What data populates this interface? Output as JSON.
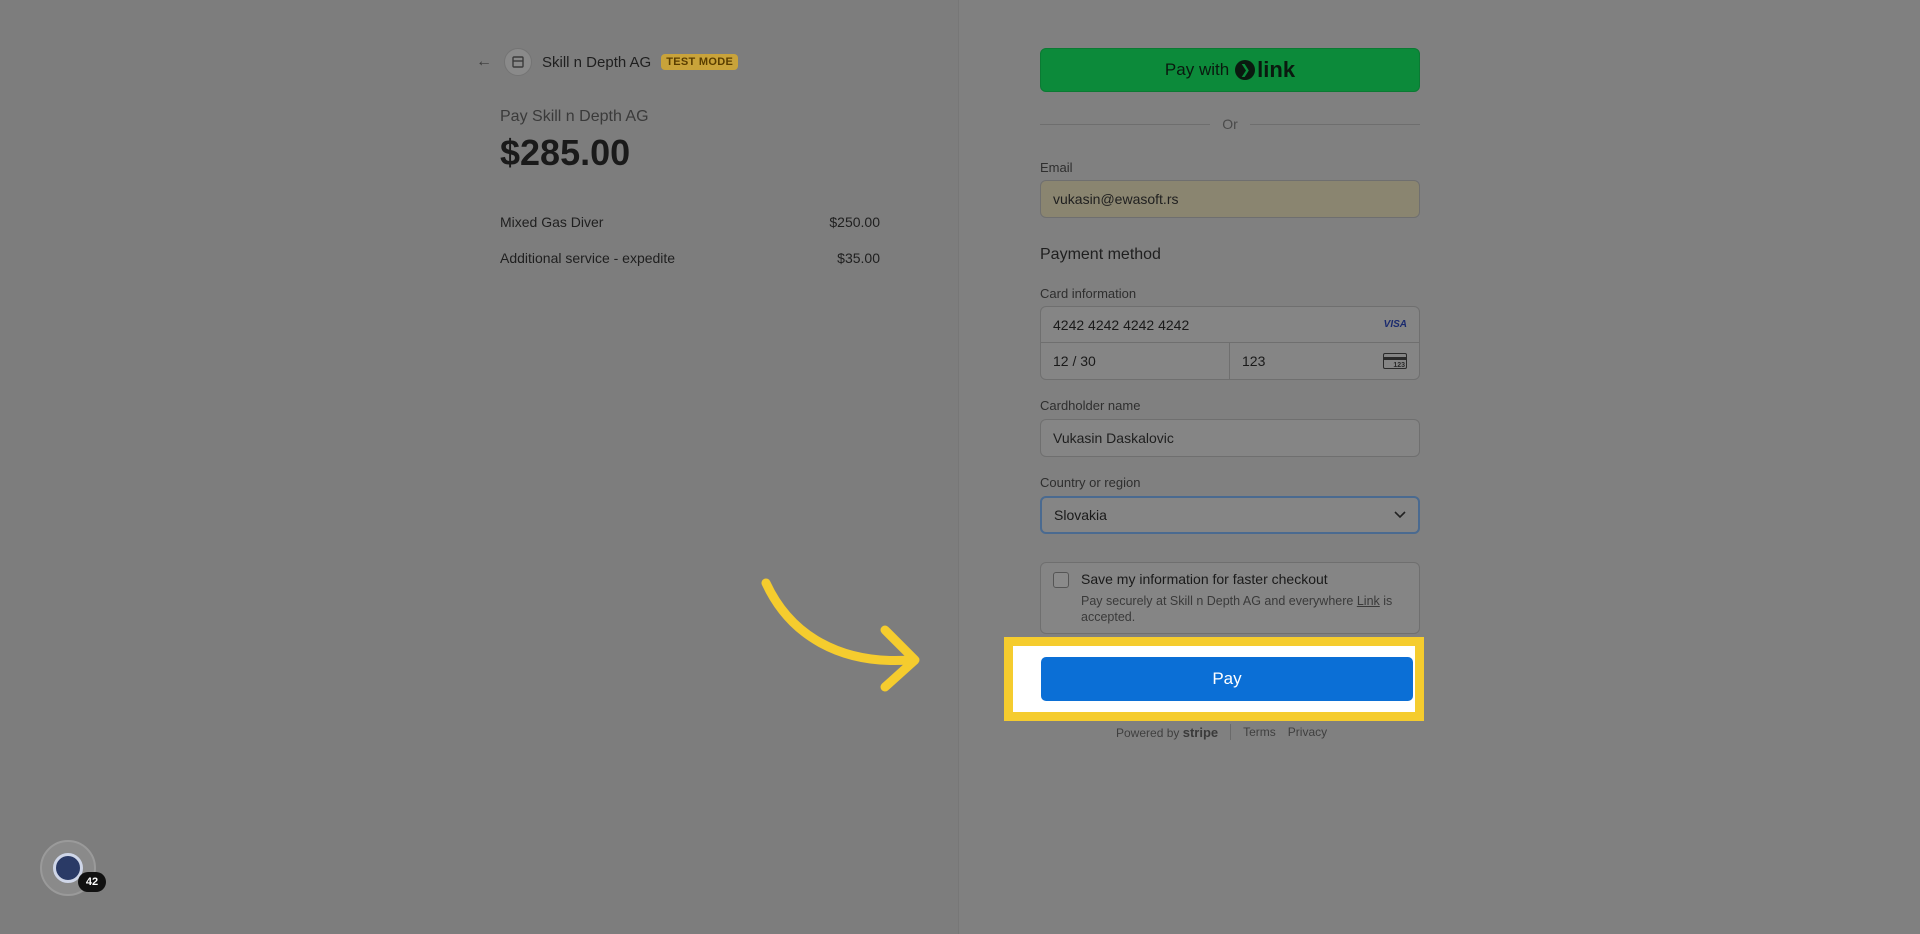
{
  "header": {
    "merchant_name": "Skill n Depth AG",
    "test_badge": "TEST MODE"
  },
  "summary": {
    "pay_to": "Pay Skill n Depth AG",
    "amount": "$285.00",
    "items": [
      {
        "name": "Mixed Gas Diver",
        "price": "$250.00"
      },
      {
        "name": "Additional service - expedite",
        "price": "$35.00"
      }
    ]
  },
  "form": {
    "link_button_prefix": "Pay with",
    "link_logo_text": "link",
    "or_text": "Or",
    "email_label": "Email",
    "email_value": "vukasin@ewasoft.rs",
    "payment_method_title": "Payment method",
    "card_label": "Card information",
    "card_number": "4242 4242 4242 4242",
    "card_brand": "VISA",
    "card_expiry": "12 / 30",
    "card_cvc": "123",
    "cvc_icon_text": "123",
    "cardholder_label": "Cardholder name",
    "cardholder_value": "Vukasin Daskalovic",
    "country_label": "Country or region",
    "country_value": "Slovakia",
    "save_title": "Save my information for faster checkout",
    "save_desc_prefix": "Pay securely at Skill n Depth AG and everywhere",
    "save_desc_link": "Link",
    "save_desc_suffix": "is accepted.",
    "pay_button": "Pay"
  },
  "footer": {
    "powered_by": "Powered by",
    "stripe": "stripe",
    "terms": "Terms",
    "privacy": "Privacy"
  },
  "helper": {
    "badge_count": "42"
  },
  "colors": {
    "highlight": "#f5cc2e",
    "pay_button": "#0b6fd6",
    "link_button": "#0c8a3a",
    "arrow": "#f5cc2e"
  }
}
